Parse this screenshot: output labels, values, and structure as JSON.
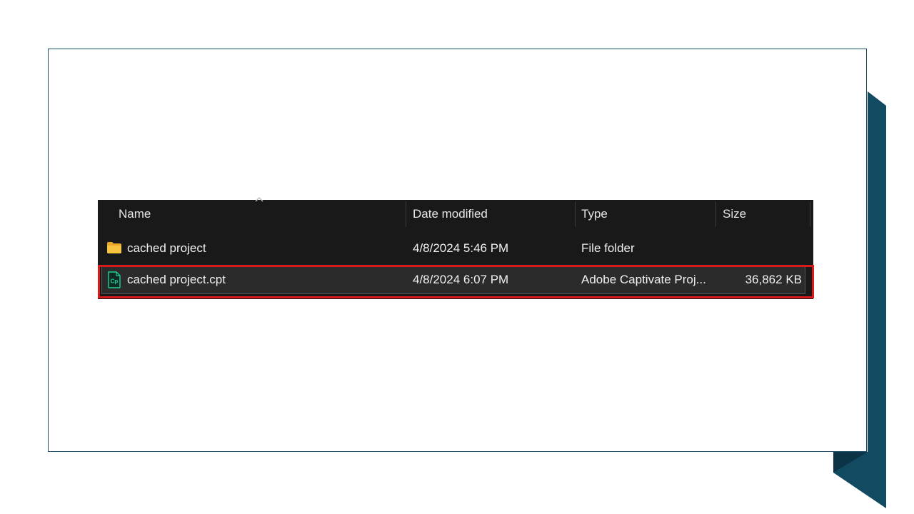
{
  "explorer": {
    "columns": {
      "name": "Name",
      "date_modified": "Date modified",
      "type": "Type",
      "size": "Size"
    },
    "rows": [
      {
        "icon": "folder-icon",
        "name": "cached project",
        "date_modified": "4/8/2024 5:46 PM",
        "type": "File folder",
        "size": ""
      },
      {
        "icon": "captivate-file-icon",
        "name": "cached project.cpt",
        "date_modified": "4/8/2024 6:07 PM",
        "type": "Adobe Captivate Proj...",
        "size": "36,862 KB"
      }
    ]
  },
  "colors": {
    "accent_dark_teal": "#124a61",
    "highlight_red": "#d91a1a",
    "explorer_bg": "#191919",
    "folder_yellow": "#f5c542",
    "captivate_green": "#1fcf9b"
  }
}
